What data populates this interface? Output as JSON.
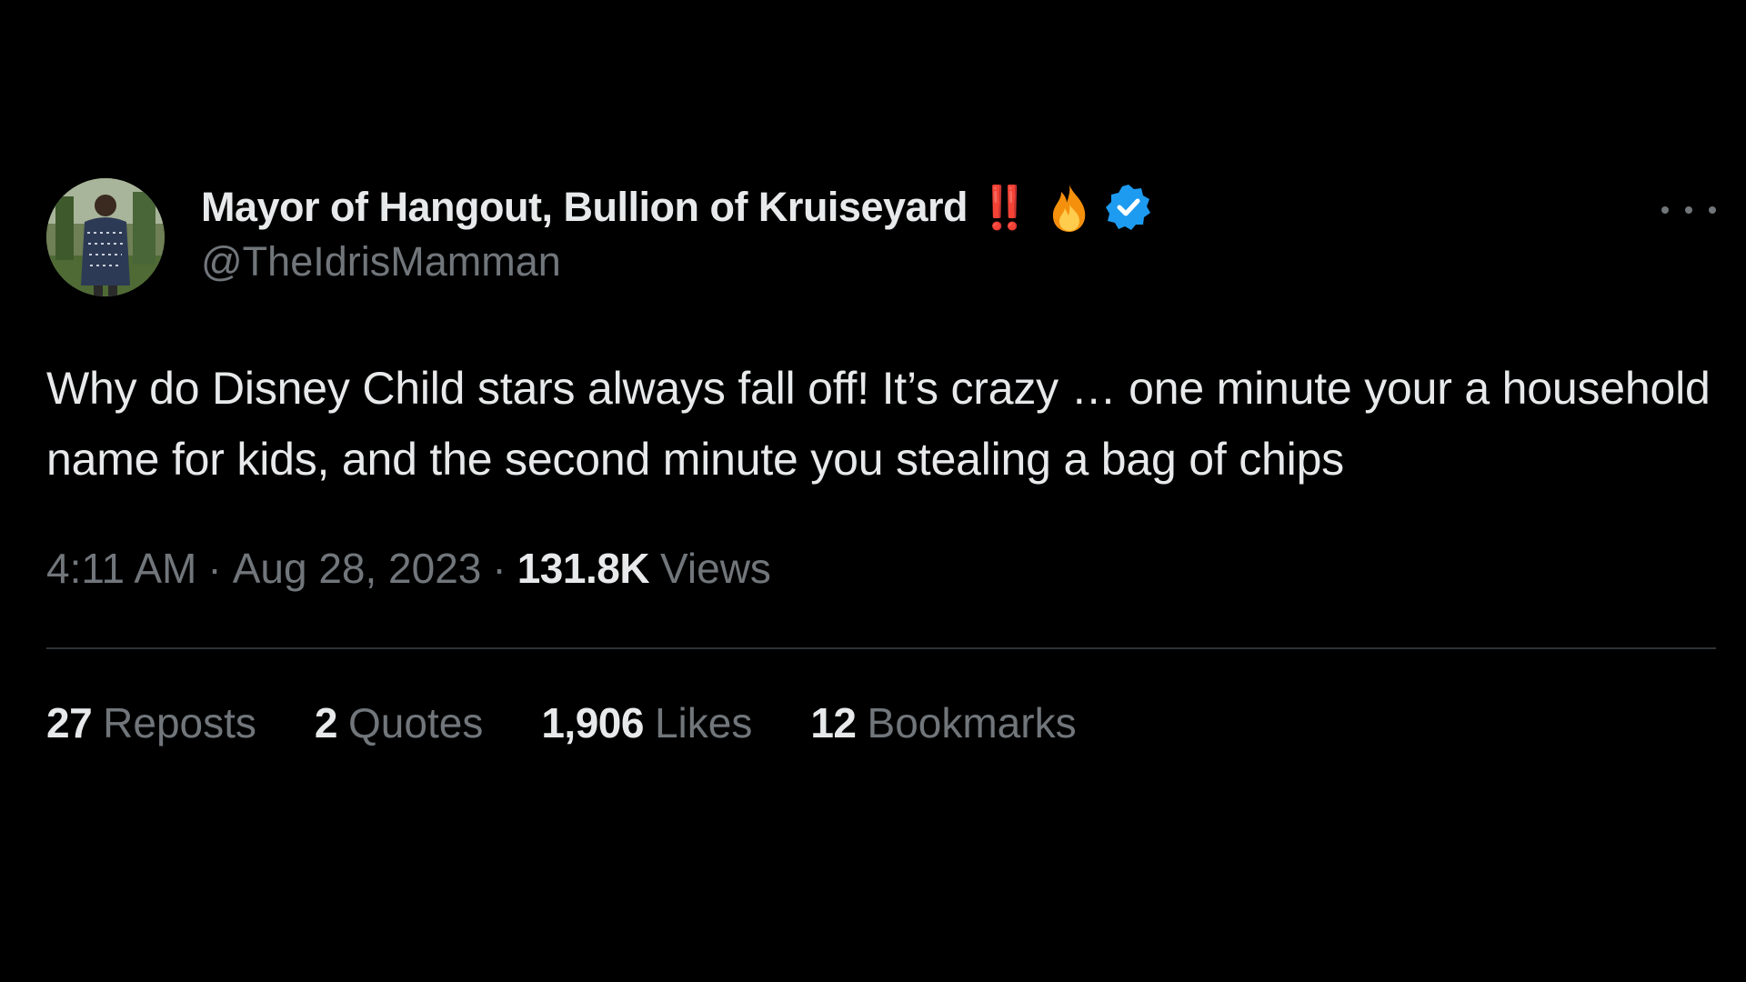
{
  "author": {
    "display_name": "Mayor of Hangout, Bullion of Kruiseyard",
    "emoji_text": "‼️",
    "handle": "@TheIdrisMamman",
    "verified_color": "#1d9bf0"
  },
  "tweet": {
    "text": "Why do Disney Child stars always fall off! It’s crazy … one minute your a household name for kids, and the second minute you stealing a bag of chips"
  },
  "meta": {
    "time": "4:11 AM",
    "date": "Aug 28, 2023",
    "separator": "·",
    "views_count": "131.8K",
    "views_label": "Views"
  },
  "stats": [
    {
      "count": "27",
      "label": "Reposts"
    },
    {
      "count": "2",
      "label": "Quotes"
    },
    {
      "count": "1,906",
      "label": "Likes"
    },
    {
      "count": "12",
      "label": "Bookmarks"
    }
  ],
  "icons": {
    "more": "more-horizontal-icon",
    "fire": "fire-emoji-icon",
    "verified": "verified-badge-icon"
  }
}
